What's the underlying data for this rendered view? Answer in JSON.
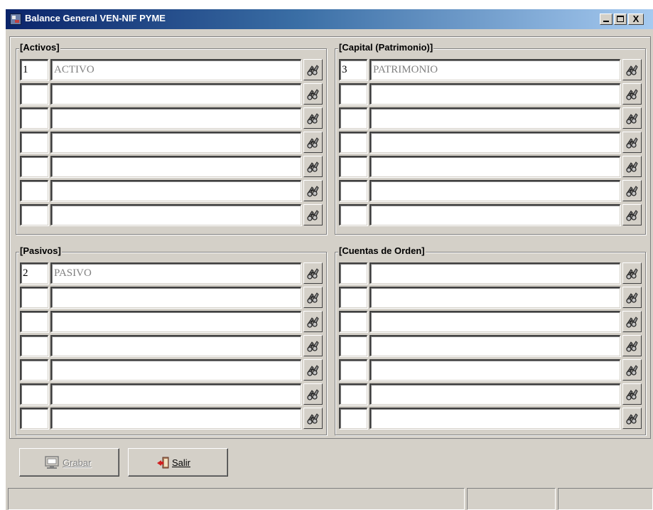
{
  "window": {
    "title": "Balance General VEN-NIF PYME",
    "controls": {
      "minimize": "_",
      "maximize": "□",
      "close": "X"
    }
  },
  "groups": {
    "activos": {
      "title": "[Activos]",
      "rows": [
        {
          "code": "1",
          "description": "ACTIVO"
        },
        {
          "code": "",
          "description": ""
        },
        {
          "code": "",
          "description": ""
        },
        {
          "code": "",
          "description": ""
        },
        {
          "code": "",
          "description": ""
        },
        {
          "code": "",
          "description": ""
        },
        {
          "code": "",
          "description": ""
        }
      ]
    },
    "capital": {
      "title": "[Capital (Patrimonio)]",
      "rows": [
        {
          "code": "3",
          "description": "PATRIMONIO"
        },
        {
          "code": "",
          "description": ""
        },
        {
          "code": "",
          "description": ""
        },
        {
          "code": "",
          "description": ""
        },
        {
          "code": "",
          "description": ""
        },
        {
          "code": "",
          "description": ""
        },
        {
          "code": "",
          "description": ""
        }
      ]
    },
    "pasivos": {
      "title": "[Pasivos]",
      "rows": [
        {
          "code": "2",
          "description": "PASIVO"
        },
        {
          "code": "",
          "description": ""
        },
        {
          "code": "",
          "description": ""
        },
        {
          "code": "",
          "description": ""
        },
        {
          "code": "",
          "description": ""
        },
        {
          "code": "",
          "description": ""
        },
        {
          "code": "",
          "description": ""
        }
      ]
    },
    "cuentas_orden": {
      "title": "[Cuentas de Orden]",
      "rows": [
        {
          "code": "",
          "description": ""
        },
        {
          "code": "",
          "description": ""
        },
        {
          "code": "",
          "description": ""
        },
        {
          "code": "",
          "description": ""
        },
        {
          "code": "",
          "description": ""
        },
        {
          "code": "",
          "description": ""
        },
        {
          "code": "",
          "description": ""
        }
      ]
    }
  },
  "buttons": {
    "grabar": {
      "label": "Grabar",
      "enabled": false,
      "icon": "monitor-icon"
    },
    "salir": {
      "label": "Salir",
      "enabled": true,
      "icon": "exit-door-icon"
    }
  },
  "icons": {
    "row_action": "search-binoculars-icon"
  },
  "colors": {
    "title_bar_start": "#0a246a",
    "title_bar_end": "#a6caf0",
    "face": "#d4d0c8",
    "field_bg": "#ffffff",
    "disabled_text": "#808080"
  }
}
